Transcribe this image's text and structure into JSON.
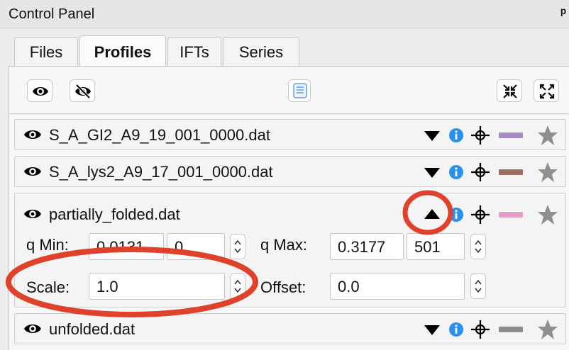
{
  "window": {
    "title": "Control Panel",
    "pin_glyph": "ᵖ"
  },
  "tabs": [
    {
      "label": "Files",
      "active": false
    },
    {
      "label": "Profiles",
      "active": true
    },
    {
      "label": "IFTs",
      "active": false
    },
    {
      "label": "Series",
      "active": false
    }
  ],
  "toolbar": {
    "buttons": [
      {
        "name": "show-all-button",
        "icon": "eye-icon"
      },
      {
        "name": "hide-all-button",
        "icon": "eye-slash-icon"
      },
      {
        "name": "select-all-button",
        "icon": "list-icon"
      },
      {
        "name": "collapse-all-button",
        "icon": "collapse-icon"
      },
      {
        "name": "expand-all-button",
        "icon": "expand-icon"
      }
    ]
  },
  "profiles": [
    {
      "filename": "S_A_GI2_A9_19_001_0000.dat",
      "line_color": "#a68bc7",
      "expanded": false
    },
    {
      "filename": "S_A_lys2_A9_17_001_0000.dat",
      "line_color": "#9c6f5e",
      "expanded": false
    },
    {
      "filename": "partially_folded.dat",
      "line_color": "#e59ccb",
      "expanded": true
    },
    {
      "filename": "unfolded.dat",
      "line_color": "#8c8c8c",
      "expanded": false
    }
  ],
  "settings": {
    "q_min_label": "q Min:",
    "q_min_value": "0.0131",
    "q_min_index": "0",
    "q_max_label": "q Max:",
    "q_max_value": "0.3177",
    "q_max_index": "501",
    "scale_label": "Scale:",
    "scale_value": "1.0",
    "offset_label": "Offset:",
    "offset_value": "0.0"
  },
  "colors": {
    "info_blue": "#2b8ff0",
    "star_gray": "#8f8f8f",
    "annotation_red": "#e0412b"
  }
}
